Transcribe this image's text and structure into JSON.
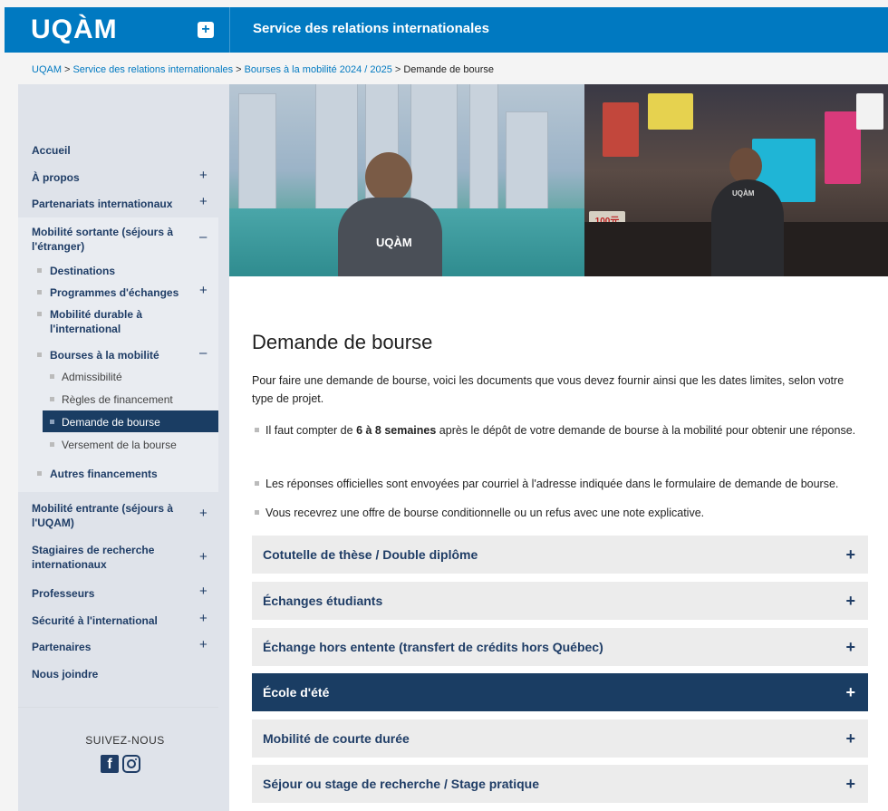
{
  "header": {
    "logo": "UQÀM",
    "menu_toggle": "+",
    "service_name": "Service des relations internationales"
  },
  "breadcrumb": [
    {
      "label": "UQAM",
      "link": true
    },
    {
      "label": "Service des relations internationales",
      "link": true
    },
    {
      "label": "Bourses à la mobilité 2024 / 2025",
      "link": true
    },
    {
      "label": "Demande de bourse",
      "link": false
    }
  ],
  "sidebar": {
    "items": [
      {
        "label": "Accueil",
        "toggle": ""
      },
      {
        "label": "À propos",
        "toggle": "+"
      },
      {
        "label": "Partenariats internationaux",
        "toggle": "+"
      },
      {
        "label": "Mobilité sortante (séjours à l'étranger)",
        "toggle": "–"
      },
      {
        "label": "Destinations",
        "toggle": ""
      },
      {
        "label": "Programmes d'échanges",
        "toggle": "+"
      },
      {
        "label": "Mobilité durable à l'international",
        "toggle": ""
      },
      {
        "label": "Bourses à la mobilité",
        "toggle": "–"
      },
      {
        "label": "Admissibilité",
        "toggle": ""
      },
      {
        "label": "Règles de financement",
        "toggle": ""
      },
      {
        "label": "Demande de bourse",
        "toggle": ""
      },
      {
        "label": "Versement de la bourse",
        "toggle": ""
      },
      {
        "label": "Autres financements",
        "toggle": ""
      },
      {
        "label": "Mobilité entrante (séjours à l'UQAM)",
        "toggle": "+"
      },
      {
        "label": "Stagiaires de recherche internationaux",
        "toggle": "+"
      },
      {
        "label": "Professeurs",
        "toggle": "+"
      },
      {
        "label": "Sécurité à l'international",
        "toggle": "+"
      },
      {
        "label": "Partenaires",
        "toggle": "+"
      },
      {
        "label": "Nous joindre",
        "toggle": ""
      }
    ],
    "follow_label": "SUIVEZ-NOUS",
    "social": [
      "facebook-icon",
      "instagram-icon"
    ]
  },
  "hero": {
    "left_shirt": "UQÀM",
    "right_shirt": "UQÀM",
    "sign_text": "100元"
  },
  "main": {
    "title": "Demande de bourse",
    "intro": "Pour faire une demande de bourse, voici les documents que vous devez fournir ainsi que les dates limites, selon votre type de projet.",
    "notes": [
      {
        "before": "Il faut compter de ",
        "bold": "6 à 8 semaines",
        "after": " après le dépôt de votre demande de bourse à la mobilité pour obtenir une réponse."
      },
      {
        "before": "Les réponses officielles sont envoyées par courriel à l'adresse indiquée dans le formulaire de demande de bourse.",
        "bold": "",
        "after": ""
      },
      {
        "before": "Vous recevrez une offre de bourse conditionnelle ou un refus avec une note explicative.",
        "bold": "",
        "after": ""
      }
    ],
    "accordion": [
      {
        "label": "Cotutelle de thèse / Double diplôme",
        "active": false,
        "icon": "+"
      },
      {
        "label": "Échanges étudiants",
        "active": false,
        "icon": "+"
      },
      {
        "label": "Échange hors entente (transfert de crédits hors Québec)",
        "active": false,
        "icon": "+"
      },
      {
        "label": "École d'été",
        "active": true,
        "icon": "+"
      },
      {
        "label": "Mobilité de courte durée",
        "active": false,
        "icon": "+"
      },
      {
        "label": "Séjour ou stage de recherche / Stage pratique",
        "active": false,
        "icon": "+"
      }
    ]
  },
  "colors": {
    "brand_blue": "#0079c1",
    "navy": "#1a3d63",
    "sidebar_bg": "#dfe3ea"
  }
}
